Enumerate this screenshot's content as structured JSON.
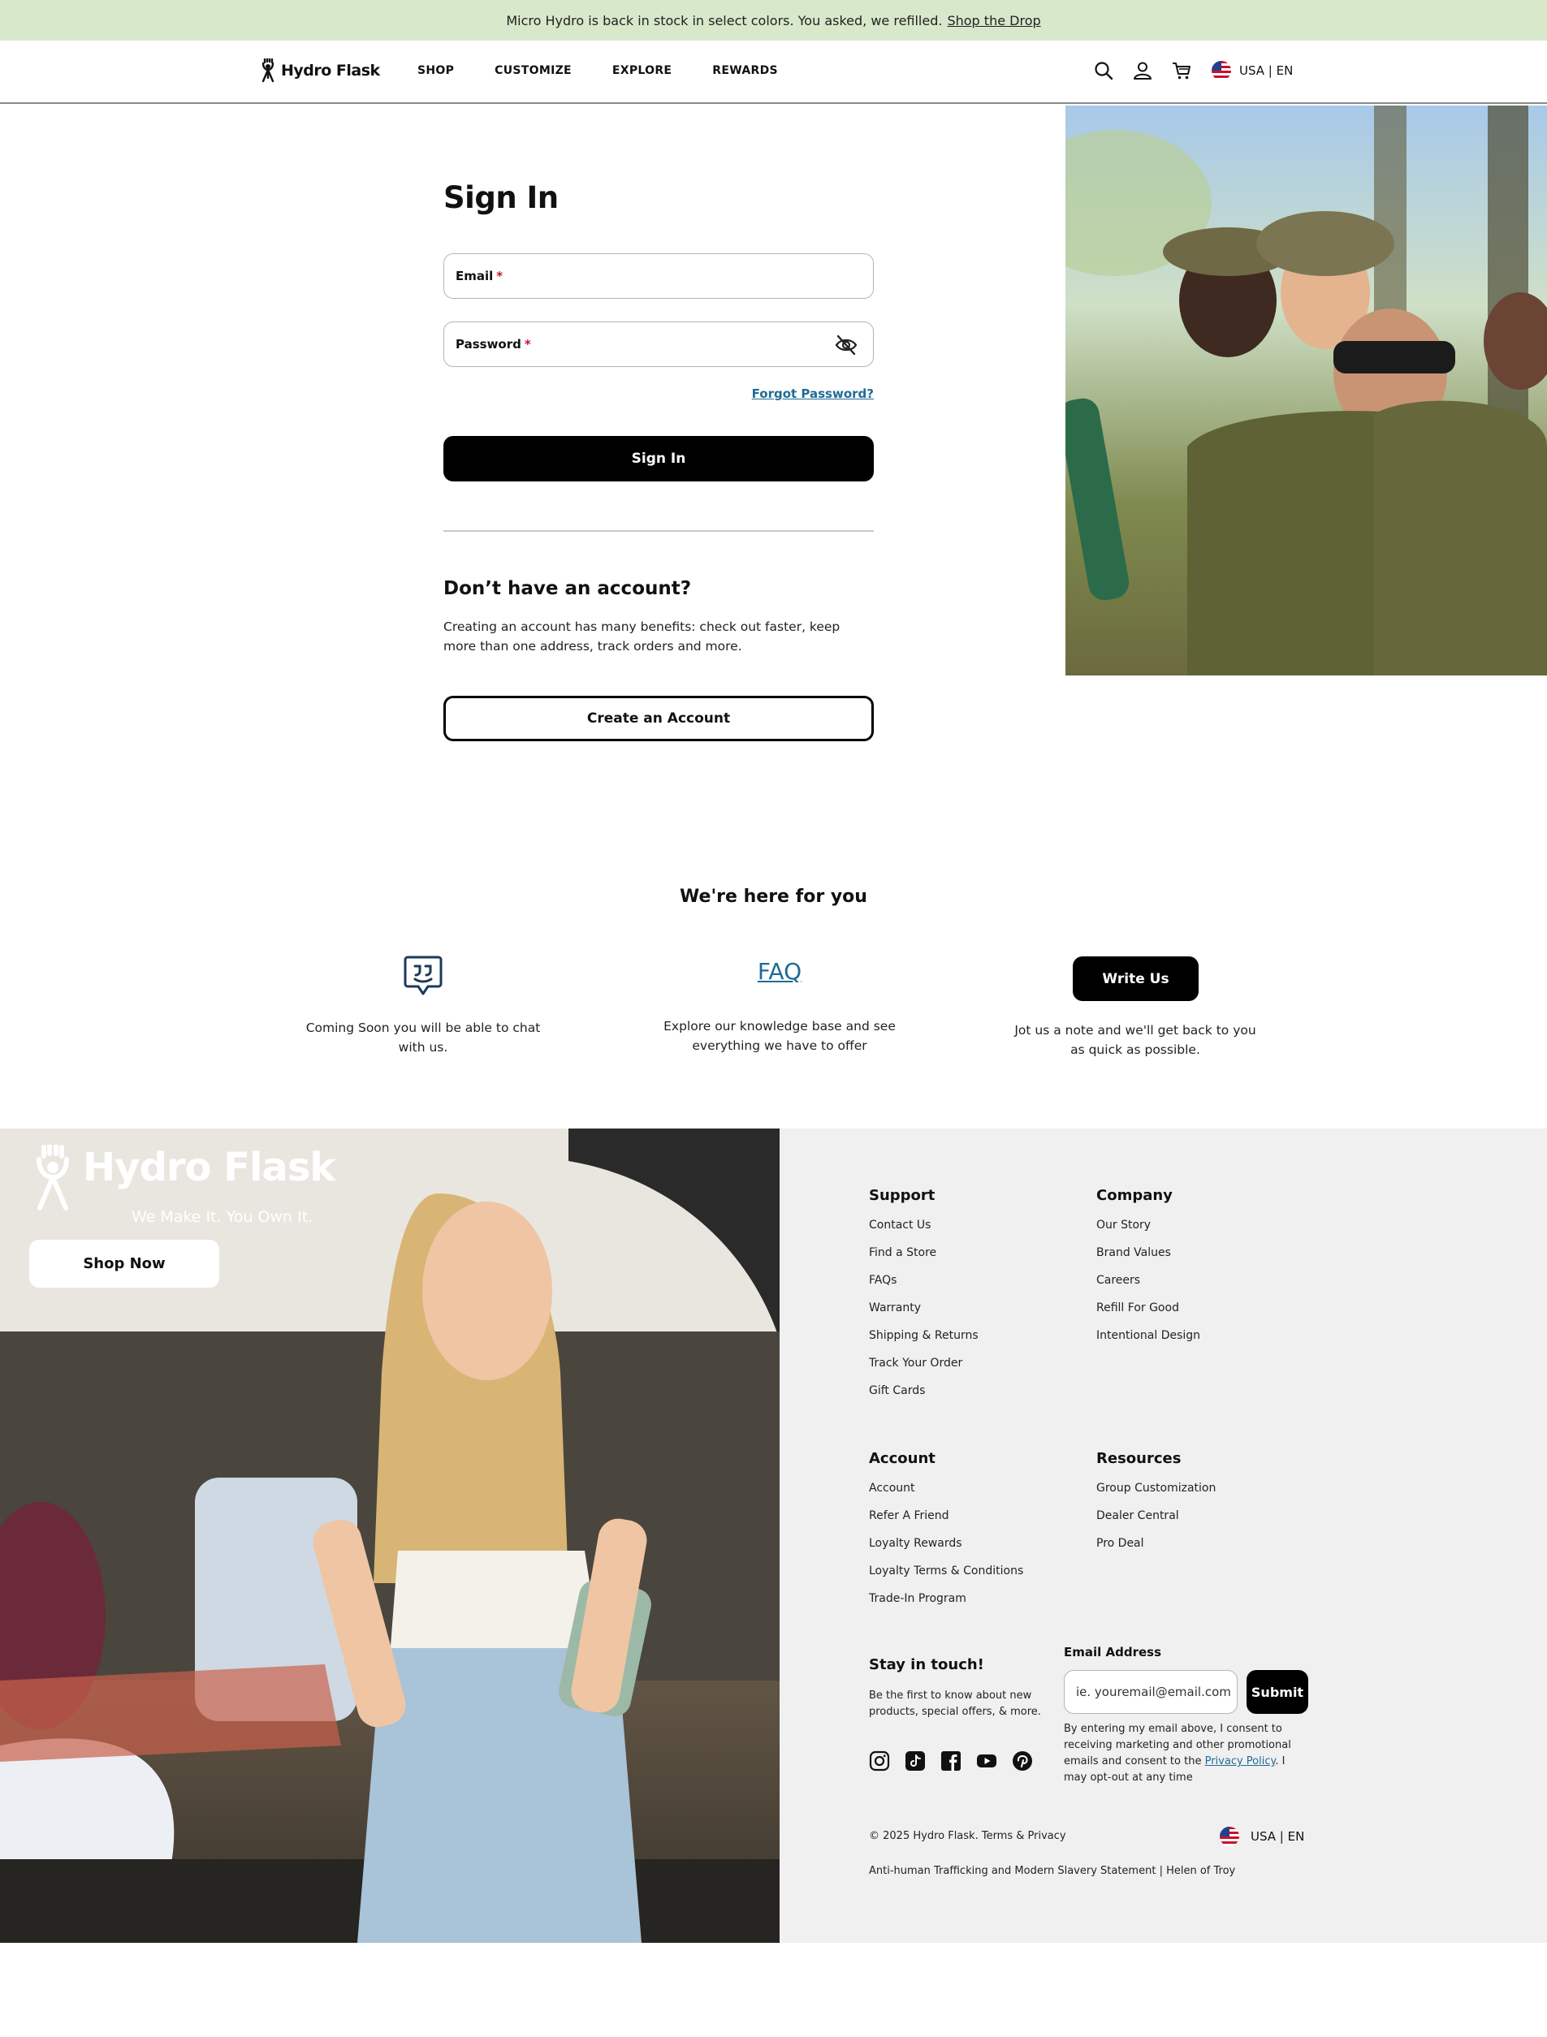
{
  "announcement": {
    "text": "Micro Hydro is back in stock in select colors. You asked, we refilled.",
    "link": "Shop the Drop"
  },
  "header": {
    "brand": "Hydro Flask",
    "nav": [
      "SHOP",
      "CUSTOMIZE",
      "EXPLORE",
      "REWARDS"
    ],
    "locale": "USA | EN"
  },
  "signin": {
    "title": "Sign In",
    "email_label": "Email",
    "password_label": "Password",
    "required_mark": "*",
    "forgot": "Forgot Password?",
    "submit": "Sign In",
    "no_account_title": "Don’t have an account?",
    "no_account_text": "Creating an account has many benefits: check out faster, keep more than one address, track orders and more.",
    "create": "Create an Account"
  },
  "support": {
    "title": "We're here for you",
    "chat_text": "Coming Soon you will be able to chat with us.",
    "faq_link": "FAQ",
    "faq_text": "Explore our knowledge base and see everything we have to offer",
    "write_button": "Write Us",
    "write_text": "Jot us a note and we'll get back to you as quick as possible."
  },
  "footer": {
    "brand": "Hydro Flask",
    "tagline": "We Make It. You Own It.",
    "shop_now": "Shop Now",
    "columns": [
      {
        "title": "Support",
        "items": [
          "Contact Us",
          "Find a Store",
          "FAQs",
          "Warranty",
          "Shipping & Returns",
          "Track Your Order",
          "Gift Cards"
        ]
      },
      {
        "title": "Company",
        "items": [
          "Our Story",
          "Brand Values",
          "Careers",
          "Refill For Good",
          "Intentional Design"
        ]
      },
      {
        "title": "Account",
        "items": [
          "Account",
          "Refer A Friend",
          "Loyalty Rewards",
          "Loyalty Terms & Conditions",
          "Trade-In Program"
        ]
      },
      {
        "title": "Resources",
        "items": [
          "Group Customization",
          "Dealer Central",
          "Pro Deal"
        ]
      }
    ],
    "stay_title": "Stay in touch!",
    "stay_text": "Be the first to know about new products, special offers, & more.",
    "socials": [
      "instagram-icon",
      "tiktok-icon",
      "facebook-icon",
      "youtube-icon",
      "pinterest-icon"
    ],
    "email_label": "Email Address",
    "email_placeholder": "ie. youremail@email.com",
    "submit": "Submit",
    "consent_pre": "By entering my email above, I consent to receiving marketing and other promotional emails and consent to the",
    "consent_link": "Privacy Policy",
    "consent_post": ". I may opt-out at any time",
    "copyright": "© 2025 Hydro Flask. Terms & Privacy",
    "locale": "USA | EN",
    "legal": "Anti-human Trafficking and Modern Slavery Statement | Helen of Troy"
  },
  "colors": {
    "announcement_bg": "#d8e8cb",
    "link": "#1f6c96",
    "required": "#c8102e",
    "footer_bg": "#f0f0f0"
  }
}
